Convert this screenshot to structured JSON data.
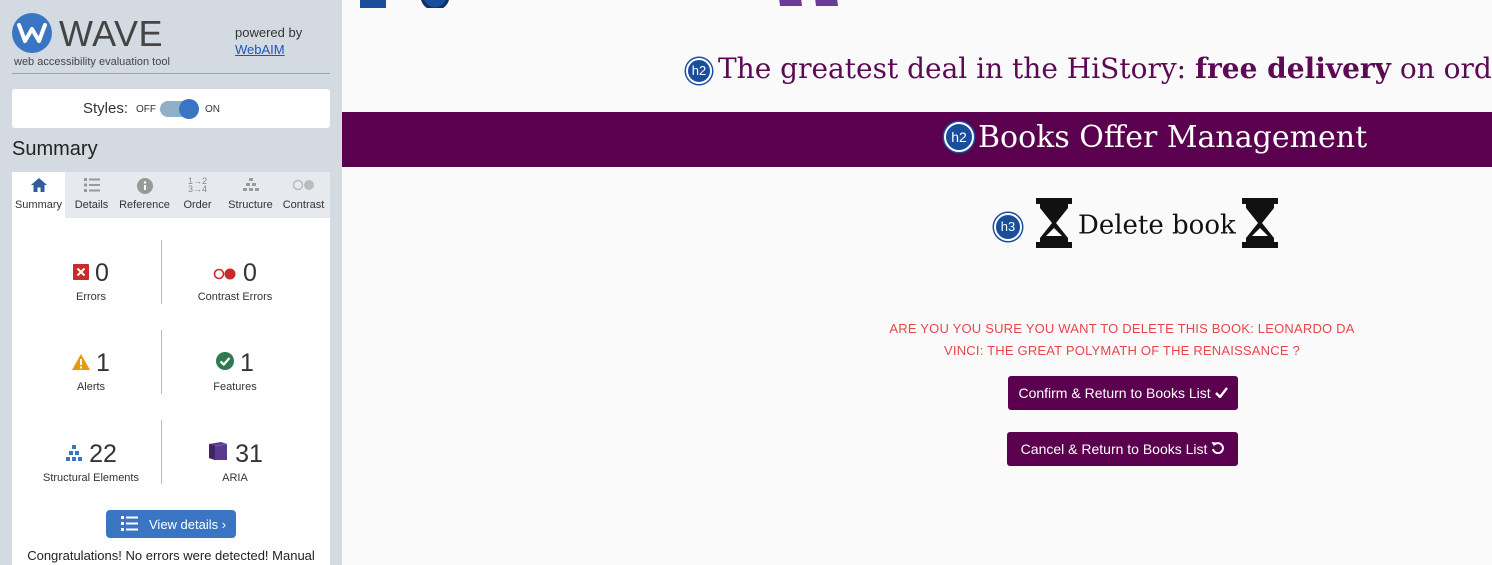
{
  "wave": {
    "title": "WAVE",
    "subtitle": "web accessibility evaluation tool",
    "powered_by": "powered by",
    "webaim_link": "WebAIM",
    "styles_label": "Styles:",
    "styles_off": "OFF",
    "styles_on": "ON",
    "summary_heading": "Summary",
    "tabs": [
      {
        "label": "Summary",
        "icon": "home-icon"
      },
      {
        "label": "Details",
        "icon": "list-icon"
      },
      {
        "label": "Reference",
        "icon": "info-icon"
      },
      {
        "label": "Order",
        "icon": "order-icon"
      },
      {
        "label": "Structure",
        "icon": "structure-icon"
      },
      {
        "label": "Contrast",
        "icon": "contrast-icon"
      }
    ],
    "active_tab": "Summary",
    "stats": {
      "errors": {
        "count": "0",
        "label": "Errors"
      },
      "contrast_errors": {
        "count": "0",
        "label": "Contrast Errors"
      },
      "alerts": {
        "count": "1",
        "label": "Alerts"
      },
      "features": {
        "count": "1",
        "label": "Features"
      },
      "structural": {
        "count": "22",
        "label": "Structural Elements"
      },
      "aria": {
        "count": "31",
        "label": "ARIA"
      }
    },
    "view_details": "View details ›",
    "congrats": "Congratulations! No errors were detected! Manual"
  },
  "page": {
    "promo": {
      "badge": "h2",
      "text_before": "The greatest deal in the HiStory: ",
      "text_bold": "free delivery",
      "text_after": " on orders over"
    },
    "banner": {
      "badge": "h2",
      "title": "Books Offer Management"
    },
    "delete_heading": {
      "badge": "h3",
      "title": "Delete book"
    },
    "question_line1": "ARE YOU YOU SURE YOU WANT TO DELETE THIS BOOK: LEONARDO DA",
    "question_line2": "VINCI: THE GREAT POLYMATH OF THE RENAISSANCE ?",
    "confirm_button": "Confirm & Return to Books List",
    "cancel_button": "Cancel & Return to Books List"
  },
  "colors": {
    "accent_purple": "#5a004e",
    "wave_blue": "#3a75c4",
    "warning_text": "#e8454f"
  }
}
